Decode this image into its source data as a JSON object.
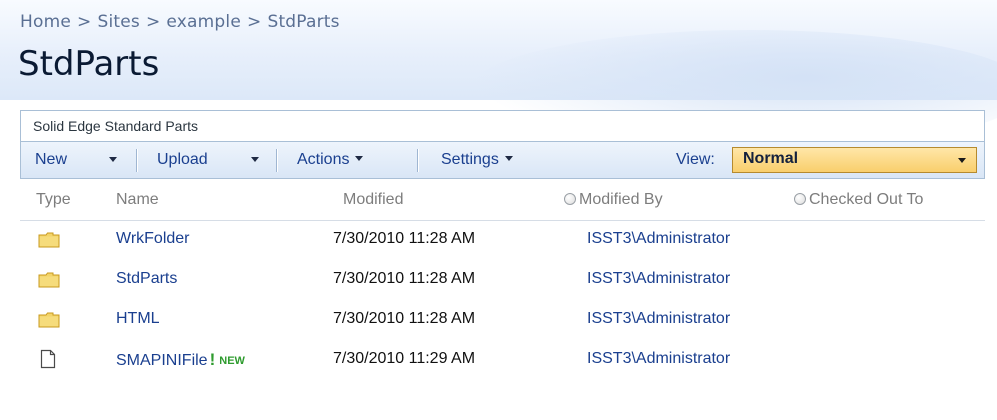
{
  "breadcrumb": [
    "Home",
    "Sites",
    "example",
    "StdParts"
  ],
  "breadcrumb_separator": ">",
  "page_title": "StdParts",
  "list_description": "Solid Edge Standard Parts",
  "toolbar": {
    "new_label": "New",
    "upload_label": "Upload",
    "actions_label": "Actions",
    "settings_label": "Settings",
    "view_label": "View:",
    "view_value": "Normal"
  },
  "columns": {
    "type": "Type",
    "name": "Name",
    "modified": "Modified",
    "modified_by": "Modified By",
    "checked_out_to": "Checked Out To"
  },
  "rows": [
    {
      "icon": "folder-icon",
      "name": "WrkFolder",
      "modified": "7/30/2010 11:28 AM",
      "modified_by": "ISST3\\Administrator",
      "checked_out_to": "",
      "new": false
    },
    {
      "icon": "folder-icon",
      "name": "StdParts",
      "modified": "7/30/2010 11:28 AM",
      "modified_by": "ISST3\\Administrator",
      "checked_out_to": "",
      "new": false
    },
    {
      "icon": "folder-icon",
      "name": "HTML",
      "modified": "7/30/2010 11:28 AM",
      "modified_by": "ISST3\\Administrator",
      "checked_out_to": "",
      "new": false
    },
    {
      "icon": "file-icon",
      "name": "SMAPINIFile",
      "modified": "7/30/2010 11:29 AM",
      "modified_by": "ISST3\\Administrator",
      "checked_out_to": "",
      "new": true,
      "new_mark": "!",
      "new_label": "NEW"
    }
  ],
  "colors": {
    "link": "#1a3f8f",
    "header_text": "#7d7d7d",
    "view_select_bg": "#f9cf6c",
    "new_flag": "#2e9b2e"
  }
}
